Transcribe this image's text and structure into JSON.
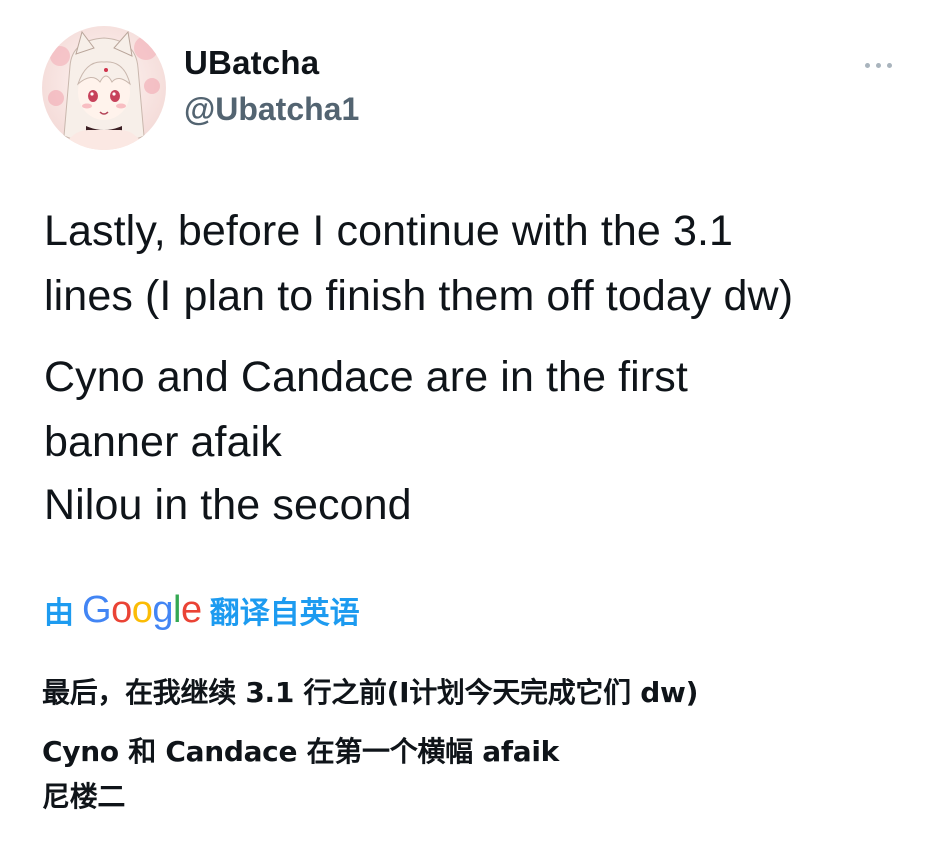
{
  "tweet": {
    "display_name": "UBatcha",
    "handle": "@Ubatcha1",
    "avatar_icon": "anime-character-avatar",
    "more_icon": "more-options-icon",
    "text_lines": [
      "Lastly, before I continue with the 3.1",
      "lines (I plan to finish them off today dw)",
      "Cyno and Candace are in the first",
      "banner afaik",
      "Nilou in the second"
    ]
  },
  "translation": {
    "by_label": "由",
    "google_letters": [
      {
        "char": "G",
        "color": "#4285f4"
      },
      {
        "char": "o",
        "color": "#ea4335"
      },
      {
        "char": "o",
        "color": "#fbbc05"
      },
      {
        "char": "g",
        "color": "#4285f4"
      },
      {
        "char": "l",
        "color": "#34a853"
      },
      {
        "char": "e",
        "color": "#ea4335"
      }
    ],
    "from_label": "翻译自英语",
    "lines": [
      "最后，在我继续 3.1 行之前(I计划今天完成它们 dw)",
      "Cyno 和 Candace 在第一个横幅 afaik",
      "尼楼二"
    ]
  },
  "colors": {
    "link": "#1d9bf0",
    "text": "#0f1419",
    "secondary": "#536471"
  }
}
